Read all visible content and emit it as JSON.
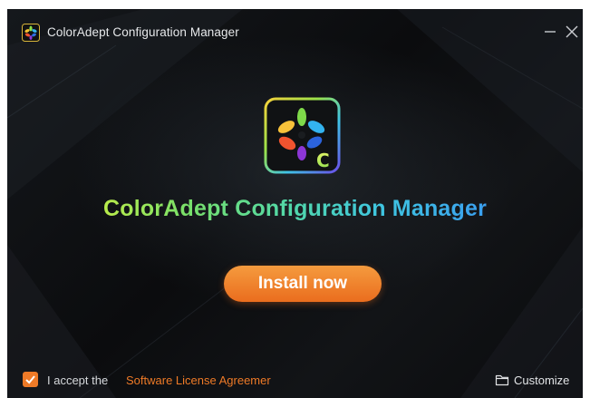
{
  "window": {
    "title": "ColorAdept Configuration Manager",
    "minimize_icon": "minimize-icon",
    "close_icon": "close-icon"
  },
  "main": {
    "logo_icon": "coloradept-logo-icon",
    "logo_letter": "C",
    "product_name": "ColorAdept Configuration Manager",
    "install_button": "Install now"
  },
  "footer": {
    "accept_checked": true,
    "accept_label": "I accept the",
    "license_link": "Software License Agreemer",
    "customize_icon": "folder-icon",
    "customize_label": "Customize"
  },
  "colors": {
    "accent": "#ee7a27",
    "background": "#0f1114",
    "title_gradient_start": "#b9ec4b",
    "title_gradient_end": "#3a9ff0"
  }
}
